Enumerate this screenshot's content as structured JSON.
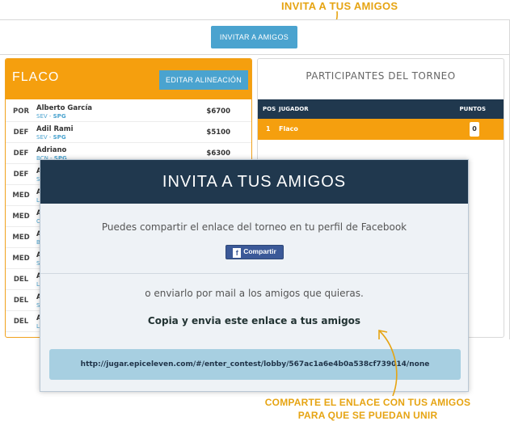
{
  "annotations": {
    "top": "INVITA A TUS AMIGOS",
    "bottom_line1": "COMPARTE EL ENLACE CON TUS AMIGOS",
    "bottom_line2": "PARA QUE SE PUEDAN UNIR",
    "color": "#e6a413"
  },
  "toolbar": {
    "invite_label": "INVITAR A AMIGOS"
  },
  "team": {
    "name": "FLACO",
    "edit_label": "EDITAR ALINEACIÓN",
    "players": [
      {
        "pos": "POR",
        "name": "Alberto García",
        "team": "SEV",
        "opp": "SPG",
        "price": "$6700"
      },
      {
        "pos": "DEF",
        "name": "Adil Rami",
        "team": "SEV",
        "opp": "SPG",
        "price": "$5100"
      },
      {
        "pos": "DEF",
        "name": "Adriano",
        "team": "BCN",
        "opp": "SPG",
        "price": "$6300"
      },
      {
        "pos": "DEF",
        "name": "A",
        "team": "S",
        "opp": "",
        "price": ""
      },
      {
        "pos": "MED",
        "name": "A",
        "team": "L",
        "opp": "",
        "price": ""
      },
      {
        "pos": "MED",
        "name": "A",
        "team": "C",
        "opp": "",
        "price": ""
      },
      {
        "pos": "MED",
        "name": "A",
        "team": "B",
        "opp": "",
        "price": ""
      },
      {
        "pos": "MED",
        "name": "A",
        "team": "S",
        "opp": "",
        "price": ""
      },
      {
        "pos": "DEL",
        "name": "A",
        "team": "L",
        "opp": "",
        "price": ""
      },
      {
        "pos": "DEL",
        "name": "A",
        "team": "S",
        "opp": "",
        "price": ""
      },
      {
        "pos": "DEL",
        "name": "A",
        "team": "L",
        "opp": "",
        "price": ""
      }
    ]
  },
  "participants": {
    "title": "PARTICIPANTES DEL TORNEO",
    "col_pos": "POS",
    "col_player": "JUGADOR",
    "col_points": "PUNTOS",
    "rows": [
      {
        "pos": "1",
        "name": "Flaco",
        "points": "0"
      }
    ]
  },
  "modal": {
    "title": "INVITA A TUS AMIGOS",
    "facebook_text": "Puedes compartir el enlace del torneo en tu perfil de Facebook",
    "facebook_button": "Compartir",
    "mail_text": "o enviarlo por mail a los amigos que quieras.",
    "copy_text": "Copia y envia este enlace a tus amigos",
    "link": "http://jugar.epiceleven.com/#/enter_contest/lobby/567ac1a6e4b0a538cf739014/none"
  },
  "colors": {
    "accent": "#f59f0e",
    "button": "#4aa3cf",
    "navy": "#20384e",
    "facebook": "#3b5998"
  }
}
